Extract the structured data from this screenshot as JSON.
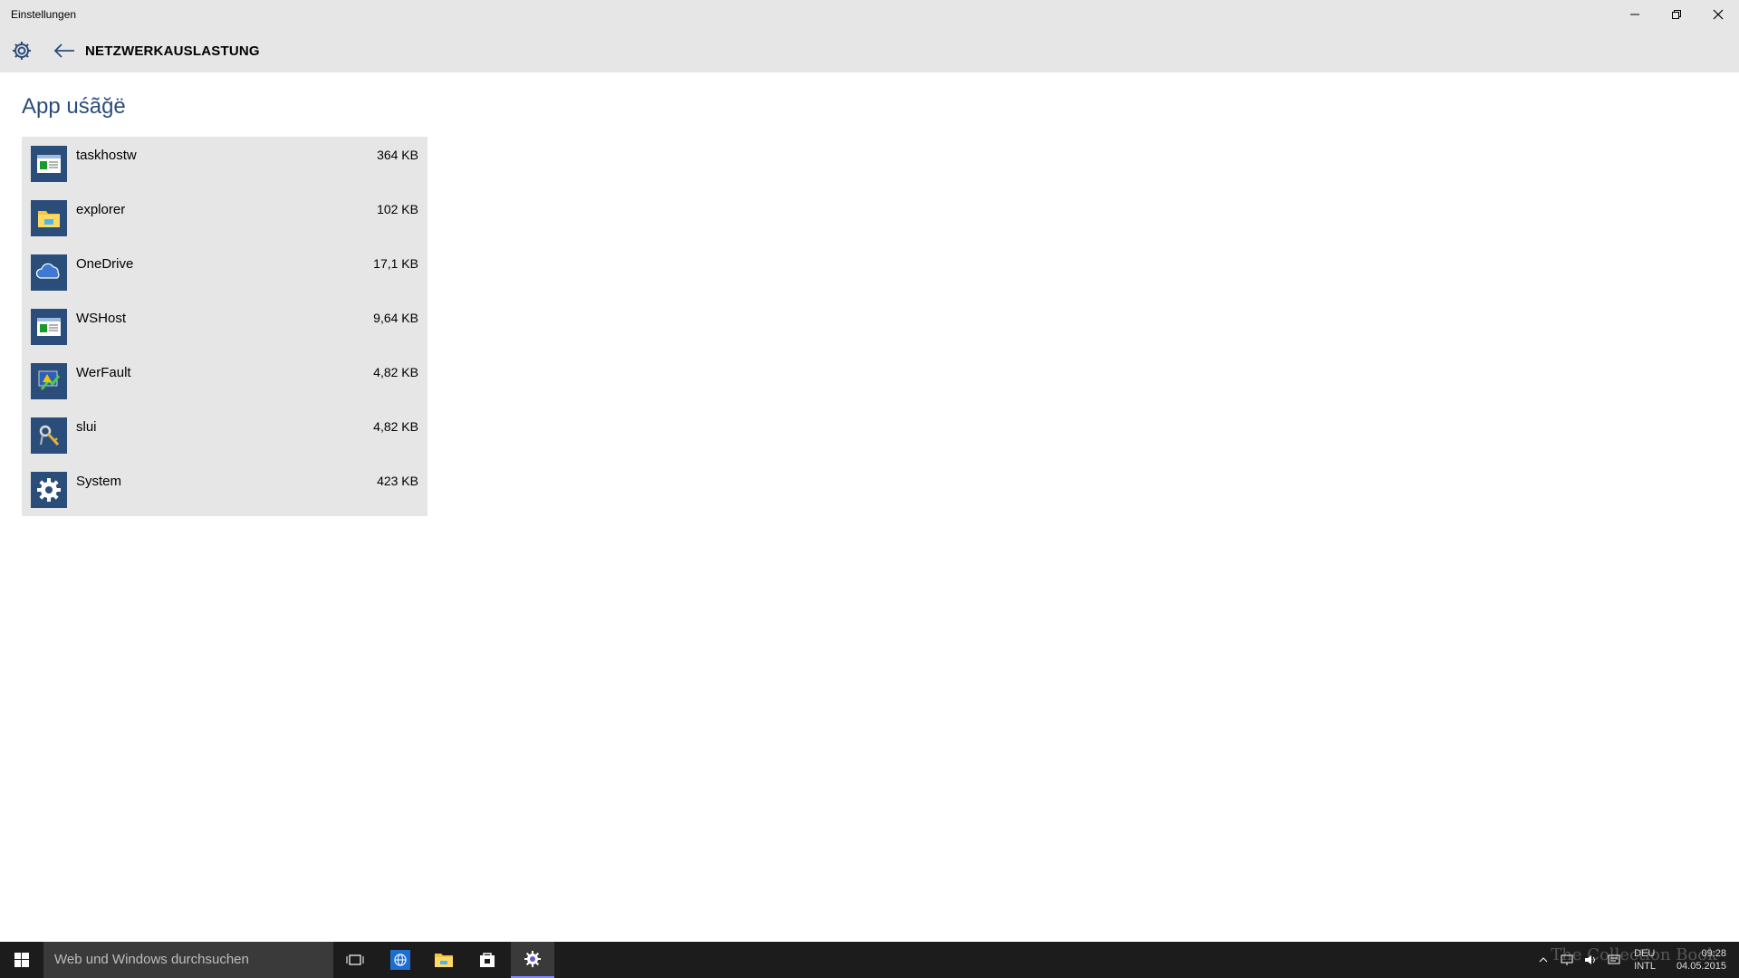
{
  "window": {
    "title": "Einstellungen"
  },
  "header": {
    "page_title": "NETZWERKAUSLASTUNG"
  },
  "main": {
    "section_title": "App uśãğë",
    "apps": [
      {
        "name": "taskhostw",
        "size": "364 KB",
        "icon": "window-app-icon"
      },
      {
        "name": "explorer",
        "size": "102 KB",
        "icon": "folder-icon"
      },
      {
        "name": "OneDrive",
        "size": "17,1 KB",
        "icon": "cloud-icon"
      },
      {
        "name": "WSHost",
        "size": "9,64 KB",
        "icon": "window-app-icon"
      },
      {
        "name": "WerFault",
        "size": "4,82 KB",
        "icon": "error-report-icon"
      },
      {
        "name": "slui",
        "size": "4,82 KB",
        "icon": "key-icon"
      },
      {
        "name": "System",
        "size": "423 KB",
        "icon": "gear-icon"
      }
    ]
  },
  "taskbar": {
    "search_placeholder": "Web und Windows durchsuchen",
    "lang_top": "DEU",
    "lang_bottom": "INTL",
    "time": "09:28",
    "date": "04.05.2015",
    "watermark": "The Collection Book"
  },
  "colors": {
    "accent": "#2b4d7a",
    "header_bg": "#e6e6e6",
    "taskbar_bg": "#1c1c1c"
  }
}
